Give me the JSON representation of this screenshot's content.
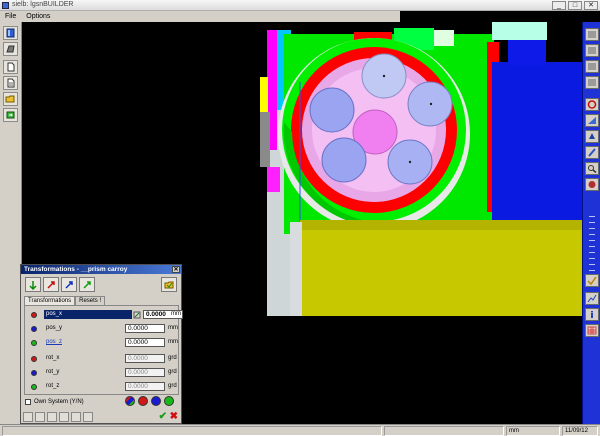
{
  "window": {
    "title": "sielb: lgsnBUILDER",
    "controls": {
      "minimize": "_",
      "maximize": "□",
      "close": "✕"
    }
  },
  "menu": {
    "items": [
      "File",
      "Options"
    ]
  },
  "dialog": {
    "title": "Transformations - __prism carroy",
    "close_glyph": "✕",
    "tabs": [
      "Transformations",
      "Resets !"
    ],
    "rows": [
      {
        "label": "pos_x",
        "value": "0.0000",
        "unit": "mm",
        "color": "#d01818",
        "selected": true,
        "disabled": false
      },
      {
        "label": "pos_y",
        "value": "0.0000",
        "unit": "mm",
        "color": "#1a1ad0",
        "selected": false,
        "disabled": false
      },
      {
        "label": "pos_z",
        "value": "0.0000",
        "unit": "mm",
        "color": "#18b818",
        "selected": false,
        "disabled": false
      },
      {
        "label": "rot_x",
        "value": "0.0000",
        "unit": "grd",
        "color": "#d01818",
        "selected": false,
        "disabled": true
      },
      {
        "label": "rot_y",
        "value": "0.0000",
        "unit": "grd",
        "color": "#1a1ad0",
        "selected": false,
        "disabled": true
      },
      {
        "label": "rot_z",
        "value": "0.0000",
        "unit": "grd",
        "color": "#18b818",
        "selected": false,
        "disabled": true
      }
    ],
    "own_system_label": "Own System (Y/N)",
    "ok_glyph": "✔",
    "cancel_glyph": "✖"
  },
  "status": {
    "unit": "mm",
    "date": "11/09/12"
  }
}
